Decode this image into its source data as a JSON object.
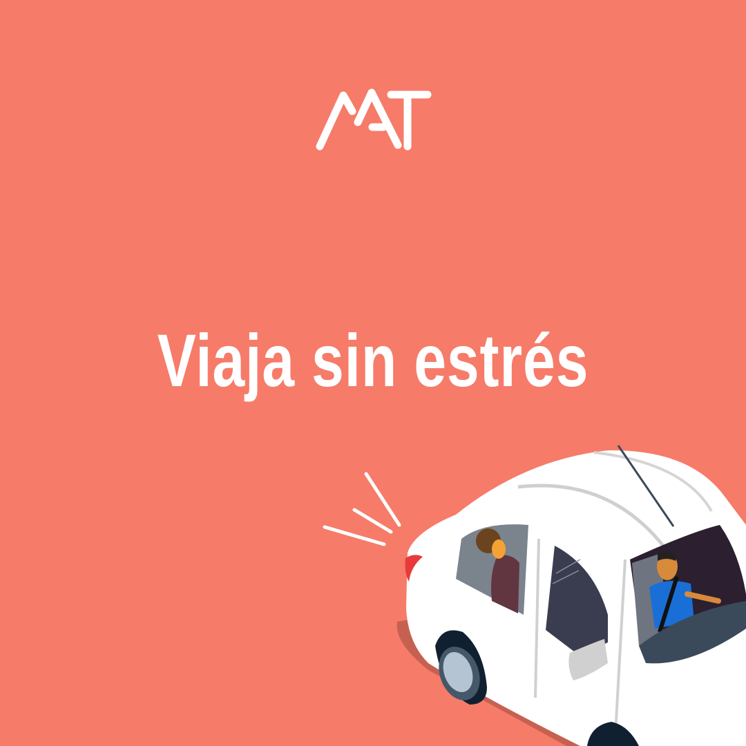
{
  "brand": {
    "logo_text": "MAT"
  },
  "headline": "Viaja sin estrés",
  "colors": {
    "background": "#f67b69",
    "text": "#ffffff",
    "car": "#ffffff",
    "shadow": "#c66152",
    "window": "#3a3f4f",
    "driver_shirt": "#1a6fd6"
  },
  "illustration": {
    "subject": "car-with-passengers-icon"
  }
}
